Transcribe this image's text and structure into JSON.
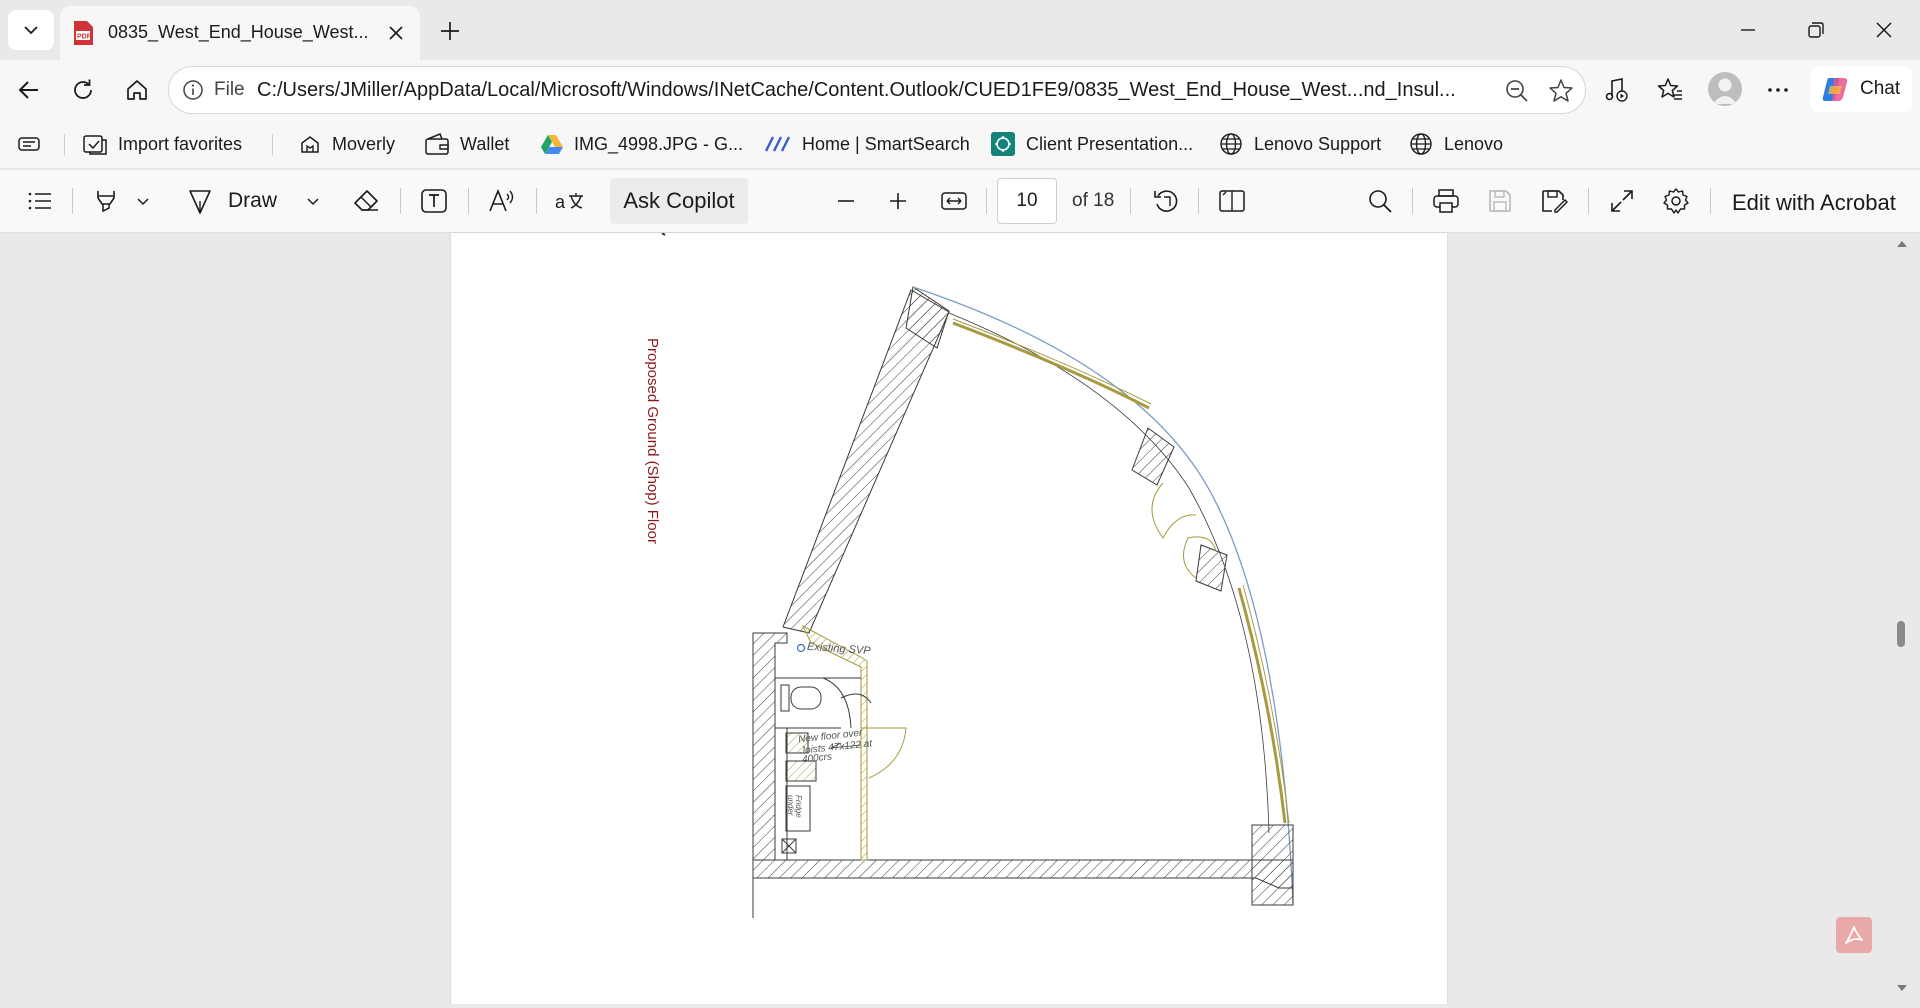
{
  "tab": {
    "title": "0835_West_End_House_West...nd_I",
    "favicon": "pdf-icon"
  },
  "address": {
    "scheme_label": "File",
    "url": "C:/Users/JMiller/AppData/Local/Microsoft/Windows/INetCache/Content.Outlook/CUED1FE9/0835_West_End_House_West...nd_Insul..."
  },
  "chat": {
    "label": "Chat"
  },
  "favorites": [
    {
      "label": "Import favorites",
      "icon": "import-icon"
    },
    {
      "label": "Moverly",
      "icon": "home-icon"
    },
    {
      "label": "Wallet",
      "icon": "wallet-icon"
    },
    {
      "label": "IMG_4998.JPG - G...",
      "icon": "google-drive-icon"
    },
    {
      "label": "Home | SmartSearch",
      "icon": "smartsearch-icon"
    },
    {
      "label": "Client Presentation...",
      "icon": "presentation-icon"
    },
    {
      "label": "Lenovo Support",
      "icon": "globe-icon"
    },
    {
      "label": "Lenovo",
      "icon": "globe-icon"
    }
  ],
  "pdf_toolbar": {
    "draw_label": "Draw",
    "ask_copilot_label": "Ask Copilot",
    "current_page": "10",
    "page_count_label": "of 18",
    "edit_acrobat_label": "Edit with Acrobat"
  },
  "drawing": {
    "floor_label": "Proposed Ground (Shop) Floor",
    "svp_note": "Existing SVP",
    "floor_note_1": "New floor over",
    "floor_note_2": "Joists 47x122 at",
    "floor_note_3": "400crs",
    "fridge_note_1": "Fridge",
    "fridge_note_2": "under"
  },
  "colors": {
    "accent": "#0f6cbd",
    "wall_line": "#3a3a3a",
    "curve_line": "#7a9bc2",
    "window_line": "#a89a40",
    "label_red": "#8b1a1a",
    "pdf_red": "#d13438"
  }
}
